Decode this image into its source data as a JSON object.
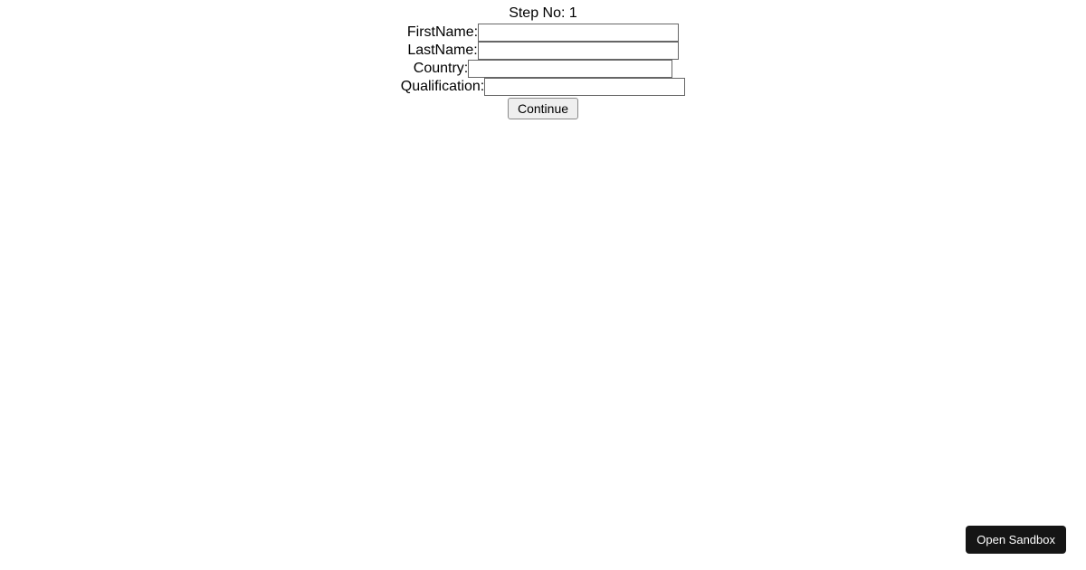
{
  "form": {
    "step_label_prefix": "Step No: ",
    "step_number": "1",
    "fields": [
      {
        "label": "FirstName:",
        "value": ""
      },
      {
        "label": "LastName:",
        "value": ""
      },
      {
        "label": "Country:",
        "value": ""
      },
      {
        "label": "Qualification:",
        "value": ""
      }
    ],
    "continue_label": "Continue"
  },
  "sandbox": {
    "open_label": "Open Sandbox"
  }
}
